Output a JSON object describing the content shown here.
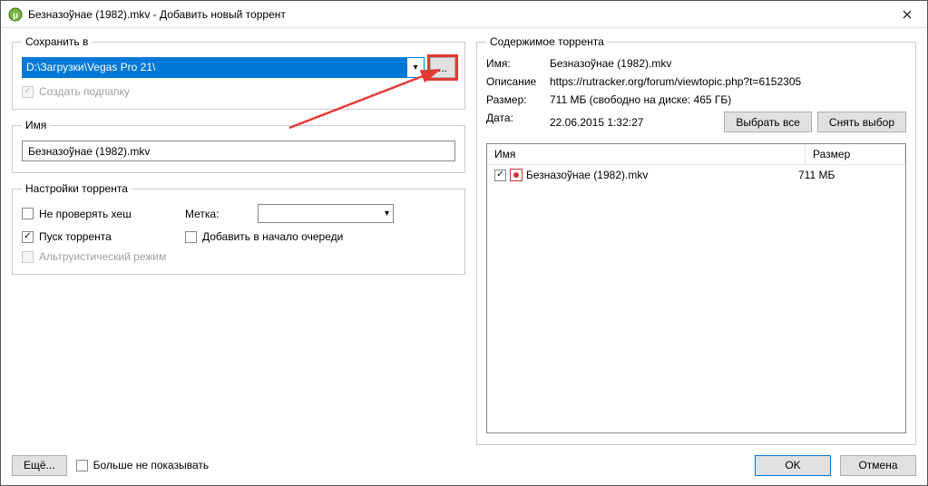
{
  "window": {
    "title": "Безназоўнае (1982).mkv - Добавить новый торрент"
  },
  "save": {
    "legend": "Сохранить в",
    "path": "D:\\Загрузки\\Vegas Pro 21\\",
    "browse": "...",
    "subfolder_label": "Создать подпапку"
  },
  "name": {
    "legend": "Имя",
    "value": "Безназоўнае (1982).mkv"
  },
  "settings": {
    "legend": "Настройки торрента",
    "skip_hash": "Не проверять хеш",
    "start_torrent": "Пуск торрента",
    "altruistic": "Альтруистический режим",
    "label_label": "Метка:",
    "add_top": "Добавить в начало очереди"
  },
  "contents": {
    "legend": "Содержимое торрента",
    "name_label": "Имя:",
    "name_value": "Безназоўнае (1982).mkv",
    "desc_label": "Описание",
    "desc_value": "https://rutracker.org/forum/viewtopic.php?t=6152305",
    "size_label": "Размер:",
    "size_value": "711 МБ (свободно на диске: 465 ГБ)",
    "date_label": "Дата:",
    "date_value": "22.06.2015 1:32:27",
    "select_all": "Выбрать все",
    "deselect_all": "Снять выбор",
    "col_name": "Имя",
    "col_size": "Размер",
    "files": [
      {
        "name": "Безназоўнае (1982).mkv",
        "size": "711 МБ"
      }
    ]
  },
  "footer": {
    "more": "Ещё...",
    "dont_show": "Больше не показывать",
    "ok": "OK",
    "cancel": "Отмена"
  }
}
